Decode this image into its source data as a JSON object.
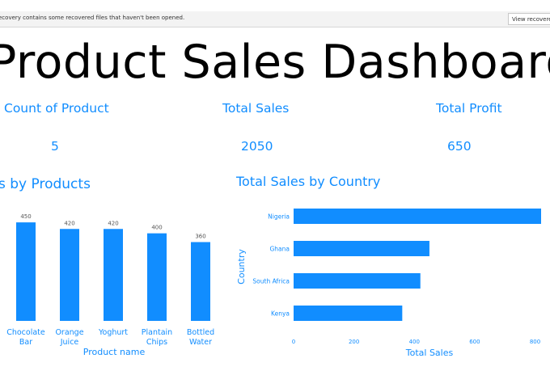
{
  "notification": {
    "message": "ecovery contains some recovered files that haven't been opened.",
    "button_label": "View recovered files"
  },
  "dashboard": {
    "title": "Product Sales Dashboard"
  },
  "kpis": [
    {
      "label": "Count of Product",
      "value": "5"
    },
    {
      "label": "Total Sales",
      "value": "2050"
    },
    {
      "label": "Total Profit",
      "value": "650"
    }
  ],
  "colors": {
    "accent": "#118dff",
    "bar": "#118dff",
    "title": "#000000",
    "notification_bg": "#f3f3f3"
  },
  "chart_data": [
    {
      "type": "bar",
      "title": "s by Products",
      "categories": [
        "Chocolate\nBar",
        "Orange\nJuice",
        "Yoghurt",
        "Plantain\nChips",
        "Bottled\nWater"
      ],
      "values": [
        450,
        420,
        420,
        400,
        360
      ],
      "xlabel": "Product name",
      "ylabel": "",
      "ylim": [
        0,
        480
      ],
      "data_labels": true,
      "grid": false
    },
    {
      "type": "bar",
      "orientation": "horizontal",
      "title": "Total Sales by Country",
      "categories": [
        "Nigeria",
        "Ghana",
        "South Africa",
        "Kenya"
      ],
      "values": [
        820,
        450,
        420,
        360
      ],
      "xlabel": "Total Sales",
      "ylabel": "Country",
      "xlim": [
        0,
        820
      ],
      "ticks": [
        "0",
        "200",
        "400",
        "600",
        "800"
      ],
      "tick_values": [
        0,
        200,
        400,
        600,
        800
      ],
      "grid": false
    }
  ]
}
